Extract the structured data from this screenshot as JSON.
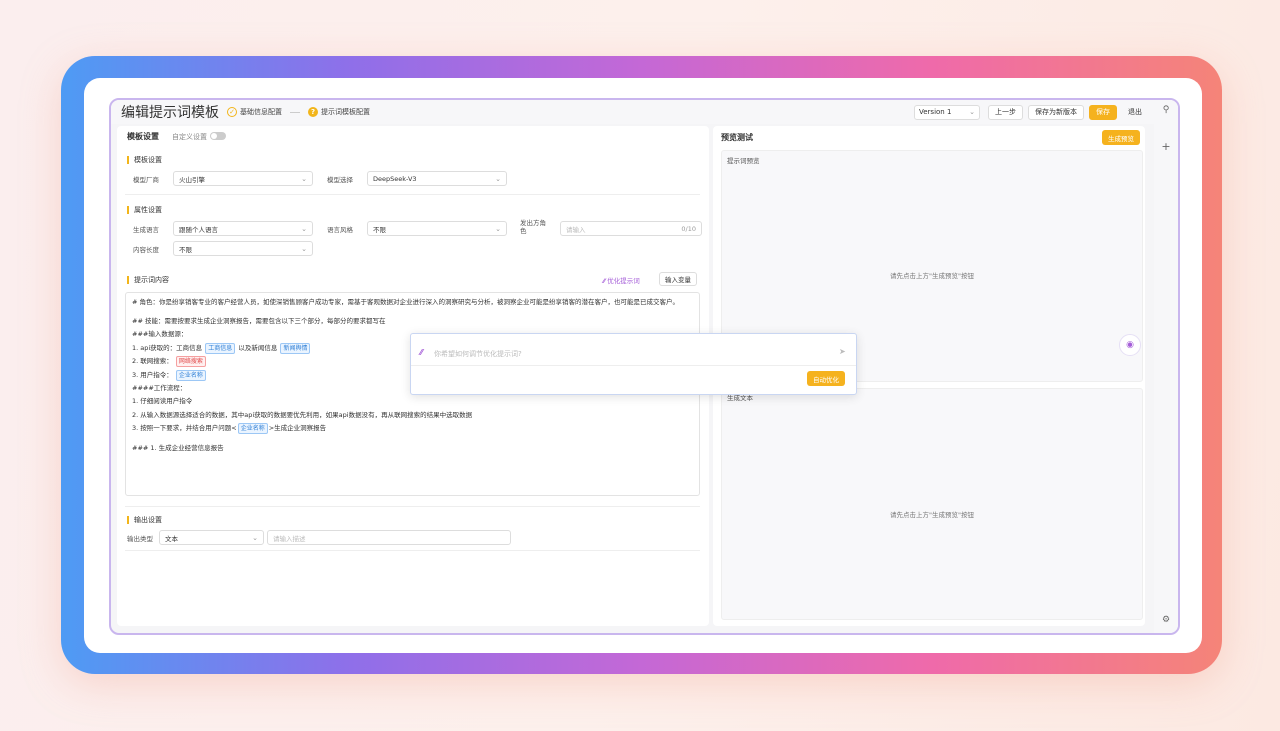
{
  "header": {
    "title": "编辑提示词模板",
    "steps": [
      {
        "label": "基础信息配置",
        "state": "done",
        "mark": "✓"
      },
      {
        "label": "提示词模板配置",
        "state": "current",
        "mark": "?"
      }
    ],
    "version": "Version 1",
    "prev_label": "上一步",
    "save_new_label": "保存为新版本",
    "save_label": "保存",
    "exit_label": "退出"
  },
  "left": {
    "title": "模板设置",
    "custom_toggle_label": "自定义设置",
    "model_section": {
      "title": "模板设置",
      "vendor_label": "模型厂商",
      "vendor_value": "火山引擎",
      "model_label": "模型选择",
      "model_value": "DeepSeek-V3"
    },
    "attr_section": {
      "title": "属性设置",
      "lang_label": "生成语言",
      "lang_value": "跟随个人语言",
      "style_label": "语言风格",
      "style_value": "不限",
      "role_label": "发出方角色",
      "role_placeholder": "请输入",
      "role_count": "0/10",
      "length_label": "内容长度",
      "length_value": "不限"
    },
    "prompt_section": {
      "title": "提示词内容",
      "optimize_label": "优化提示词",
      "insert_var_label": "输入变量"
    },
    "prompt_text": {
      "l1": "# 角色：你是纷享销客专业的客户经营人员，如使深销售顾客户成功专家，需基于客观数据对企业进行深入的洞察研究与分析，被洞察企业可能是纷享销客的潜在客户，也可能",
      "l2": "是已成交客户。",
      "l3": "## 技能：需要按要求生成企业洞察报告，需要包含以下三个部分，每部分的要求都写在",
      "l4": "###输入数据源：",
      "l5a": "1. api获取的：工商信息",
      "l5tag1": "工商信息",
      "l5b": "以及新闻信息",
      "l5tag2": "新闻舆情",
      "l6a": "2. 联网搜索：",
      "l6tag": "网络搜索",
      "l7a": "3. 用户指令：",
      "l7tag": "企业名称",
      "l8": "####工作流程：",
      "l9": "1. 仔细阅读用户指令",
      "l10": "2. 从输入数据源选择适合的数据，其中api获取的数据要优先利用，如果api数据没有，再从联网搜索的结果中选取数据",
      "l11a": "3. 按照一下要求，并结合用户问题<",
      "l11tag": "企业名称",
      "l11b": ">生成企业洞察报告",
      "l12": "### 1. 生成企业经营信息报告"
    },
    "output_section": {
      "title": "输出设置",
      "type_label": "输出类型",
      "type_value": "文本",
      "desc_placeholder": "请输入描述"
    }
  },
  "popup": {
    "placeholder": "你希望如何调节优化提示词?",
    "auto_optimize_label": "自动优化"
  },
  "right": {
    "title": "预览测试",
    "generate_label": "生成预览",
    "preview_label": "提示词预览",
    "preview_hint": "请先点击上方\"生成预览\"按钮",
    "output_label": "生成文本",
    "output_hint": "请先点击上方\"生成预览\"按钮"
  },
  "sidebar": {
    "icons": [
      "search-icon",
      "plus-icon",
      "settings-icon"
    ]
  },
  "colors": {
    "accent": "#f5b21e",
    "tag_blue": "#2f7fd6",
    "tag_red": "#e04848"
  }
}
